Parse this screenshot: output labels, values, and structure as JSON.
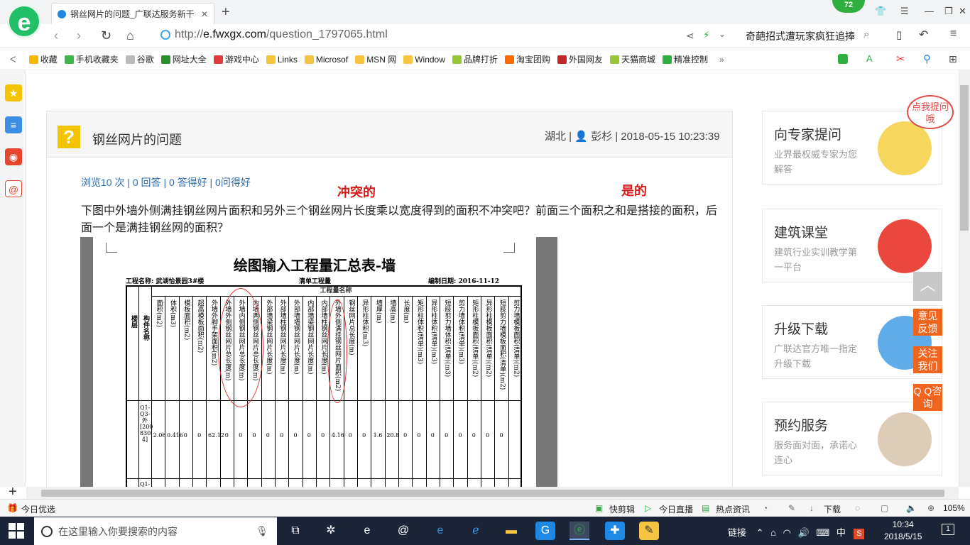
{
  "browser": {
    "logo": "e",
    "tab_title": "钢丝网片的问题_广联达服务新干",
    "tab_close": "✕",
    "new_tab": "+",
    "badge": "72",
    "url_scheme": "http://",
    "url_host": "e.fwxgx.com",
    "url_path": "/question_1797065.html",
    "search_text": "奇葩招式遭玩家疯狂追捧",
    "bookmarks": [
      {
        "label": "收藏",
        "color": "#f5b800"
      },
      {
        "label": "手机收藏夹",
        "color": "#3cb54a"
      },
      {
        "label": "谷歌",
        "color": "#bbbbbb"
      },
      {
        "label": "网址大全",
        "color": "#2a8f2a"
      },
      {
        "label": "游戏中心",
        "color": "#e03c3c"
      },
      {
        "label": "Links",
        "color": "#f5c542"
      },
      {
        "label": "Microsof",
        "color": "#f5c542"
      },
      {
        "label": "MSN 网",
        "color": "#f5c542"
      },
      {
        "label": "Window",
        "color": "#f5c542"
      },
      {
        "label": "品牌打折",
        "color": "#9ac63c"
      },
      {
        "label": "淘宝团购",
        "color": "#ff6a00"
      },
      {
        "label": "外国网友",
        "color": "#c0282e"
      },
      {
        "label": "天猫商城",
        "color": "#9ac63c"
      },
      {
        "label": "精准控制",
        "color": "#2eaf3f"
      }
    ]
  },
  "question": {
    "title": "钢丝网片的问题",
    "meta": "湖北 | 👤 彭杉 | 2018-05-15 10:23:39",
    "stats": "浏览10 次 | 0 回答 | 0 答得好 | 0问得好",
    "annotation_left": "冲突的",
    "annotation_right": "是的",
    "body": "下图中外墙外侧满挂钢丝网片面积和另外三个钢丝网片长度乘以宽度得到的面积不冲突吧？前面三个面积之和是搭接的面积，后面一个是满挂钢丝网的面积？"
  },
  "scan": {
    "title": "绘图输入工程量汇总表-墙",
    "project": "工程名称: 武湖怡景园3#楼",
    "mode": "清单工程量",
    "date": "编制日期: 2016-11-12",
    "group_header": "工程量名称",
    "columns": [
      "楼层",
      "构件名称",
      "面积(m2)",
      "体积(m3)",
      "模板面积(m2)",
      "超高模板面积(m2)",
      "外墙外脚手架面积(m2)",
      "外墙外侧钢丝网片总长度(m)",
      "外墙内侧钢丝网片总长度(m)",
      "内墙两侧钢丝网片总长度(m)",
      "外部墙梁钢丝网片长度(m)",
      "外部墙柱钢丝网片长度(m)",
      "外部墙墙钢丝网片长度(m)",
      "内部墙梁钢丝网片长度(m)",
      "内部墙柱钢丝网片长度(m)",
      "外墙外侧满挂钢丝网片面积(m2)",
      "钢丝网片总长度(m)",
      "异形柱体积(m3)",
      "墙厚(m)",
      "墙高(m)",
      "长度(m)",
      "矩形柱体积(清单)(m3)",
      "异形柱体积(清单)(m3)",
      "短肢剪力墙体积(清单)(m3)",
      "剪力墙体积(清单)(m3)",
      "矩形柱模板面积(清单)(m2)",
      "异形柱模板面积(清单)(m2)",
      "短肢剪力墙模板面积(清单)(m2)",
      "剪力墙模板面积(清单)(m2)"
    ],
    "row1_name": "Q1-Q3-外[200 830 4]",
    "row1_values": [
      "2.06",
      "0.416",
      "0",
      "0",
      "62.12",
      "0",
      "0",
      "0",
      "0",
      "0",
      "0",
      "0",
      "0",
      "4.16",
      "0",
      "0",
      "1.6",
      "20.8",
      "0",
      "0",
      "0",
      "0",
      "0",
      "0",
      "0",
      "0"
    ],
    "row2_name": "Q1-Q3-"
  },
  "sidebar": {
    "cards": [
      {
        "title": "向专家提问",
        "sub": "业界最权威专家为您解答"
      },
      {
        "title": "建筑课堂",
        "sub": "建筑行业实训教学第一平台"
      },
      {
        "title": "升级下载",
        "sub": "广联达官方唯一指定升级下载"
      },
      {
        "title": "预约服务",
        "sub": "服务面对面，承诺心连心"
      }
    ],
    "bubble": "点我提问哦",
    "float_buttons": [
      "意见反馈",
      "关注我们",
      "Q Q咨询"
    ]
  },
  "status": {
    "left": "今日优选",
    "items": [
      "快剪辑",
      "今日直播",
      "热点资讯"
    ],
    "download": "下载",
    "zoom": "105%"
  },
  "taskbar": {
    "search_placeholder": "在这里输入你要搜索的内容",
    "tray_label": "链接",
    "ime": "中",
    "time": "10:34",
    "date": "2018/5/15",
    "notifications": "1"
  }
}
